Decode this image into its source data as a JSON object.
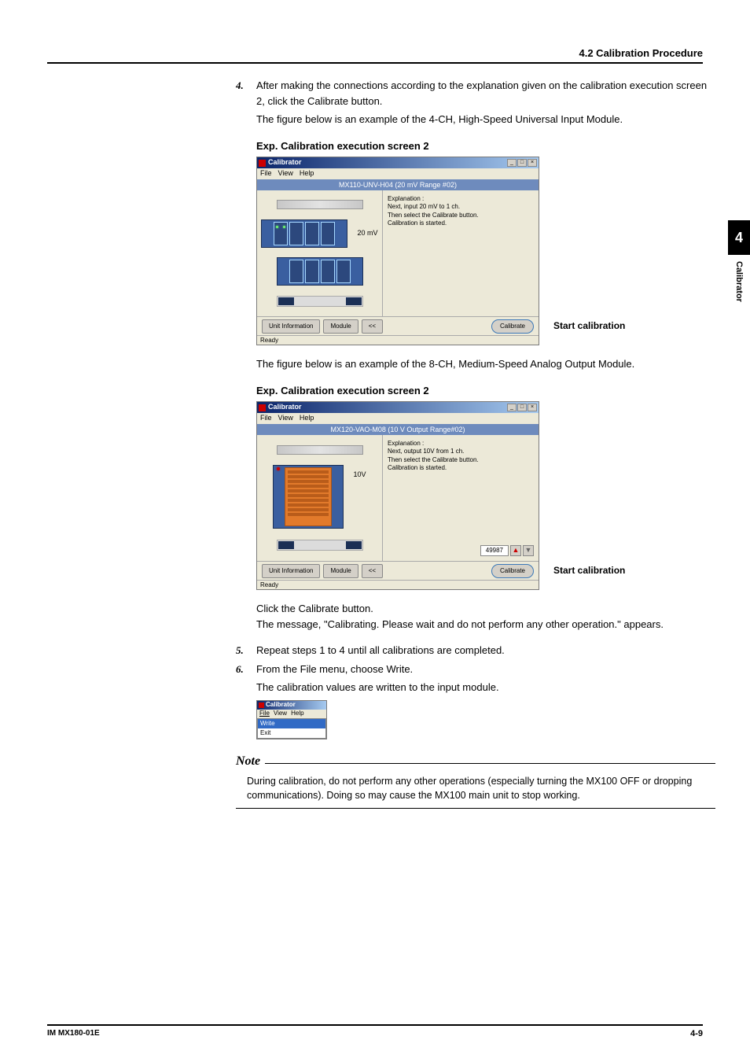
{
  "header": {
    "section": "4.2  Calibration Procedure"
  },
  "sidetab": {
    "chapter_num": "4",
    "chapter_name": "Calibrator"
  },
  "steps": {
    "s4": {
      "num": "4.",
      "text": "After making the connections according to the explanation given on the calibration execution screen 2, click the Calibrate button."
    },
    "s4_sub": "The figure below is an example of the 4-CH, High-Speed Universal Input Module.",
    "s4_mid": "The figure below is an example of the 8-CH, Medium-Speed Analog Output Module.",
    "s4_click": "Click the Calibrate button.",
    "s4_msg": "The message, \"Calibrating. Please wait and do not perform any other operation.\" appears.",
    "s5": {
      "num": "5.",
      "text": "Repeat steps 1 to 4 until all calibrations are completed."
    },
    "s6": {
      "num": "6.",
      "text": "From the File menu, choose Write."
    },
    "s6_sub": "The calibration values are written to the input module."
  },
  "fig1": {
    "label": "Exp.   Calibration execution screen 2",
    "win_title": "Calibrator",
    "menu": {
      "file": "File",
      "view": "View",
      "help": "Help"
    },
    "module_header": "MX110-UNV-H04 (20 mV Range #02)",
    "signal_label": "20 mV",
    "explanation_label": "Explanation :",
    "explanation1": "Next, input 20 mV to 1 ch.",
    "explanation2": "Then select the Calibrate button.",
    "explanation3": "Calibration is started.",
    "btn_unit": "Unit Information",
    "btn_module": "Module",
    "btn_back": "<<",
    "btn_cal": "Calibrate",
    "status": "Ready",
    "callout": "Start calibration"
  },
  "fig2": {
    "label": "Exp.   Calibration execution screen 2",
    "win_title": "Calibrator",
    "menu": {
      "file": "File",
      "view": "View",
      "help": "Help"
    },
    "module_header": "MX120-VAO-M08 (10 V Output Range#02)",
    "signal_label": "10V",
    "explanation_label": "Explanation :",
    "explanation1": "Next, output 10V from 1 ch.",
    "explanation2": "Then select the Calibrate button.",
    "explanation3": "Calibration is started.",
    "num_value": "49987",
    "btn_unit": "Unit Information",
    "btn_module": "Module",
    "btn_back": "<<",
    "btn_cal": "Calibrate",
    "status": "Ready",
    "callout": "Start calibration"
  },
  "mini": {
    "title": "Calibrator",
    "menu": {
      "file": "File",
      "view": "View",
      "help": "Help"
    },
    "item_write": "Write",
    "item_exit": "Exit"
  },
  "note": {
    "heading": "Note",
    "body": "During calibration, do not perform any other operations (especially turning the MX100 OFF or dropping communications). Doing so may cause the MX100 main unit to stop working."
  },
  "footer": {
    "left": "IM MX180-01E",
    "right": "4-9"
  }
}
